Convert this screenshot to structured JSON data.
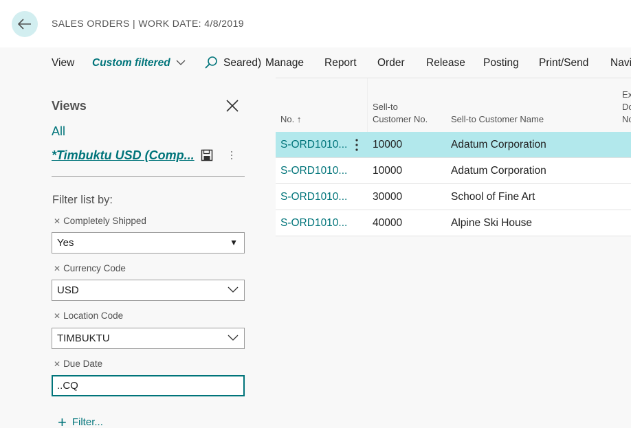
{
  "header": {
    "title": "SALES ORDERS | WORK DATE: 4/8/2019"
  },
  "actions": {
    "view": "View",
    "filtered": "Custom filtered",
    "search": "Seared)",
    "manage": "Manage",
    "report": "Report",
    "order": "Order",
    "release": "Release",
    "posting": "Posting",
    "print_send": "Print/Send",
    "navigate": "Navi"
  },
  "filter_pane": {
    "views_title": "Views",
    "view_all": "All",
    "current_view": "*Timbuktu USD (Comp...",
    "filter_list_by": "Filter list by:",
    "filters": [
      {
        "label": "Completely Shipped",
        "value": "Yes"
      },
      {
        "label": "Currency Code",
        "value": "USD"
      },
      {
        "label": "Location Code",
        "value": "TIMBUKTU"
      },
      {
        "label": "Due Date",
        "value": "..CQ"
      }
    ],
    "add_filter": "Filter..."
  },
  "table": {
    "columns": {
      "no": "No. ↑",
      "custno_line1": "Sell-to",
      "custno_line2": "Customer No.",
      "custname": "Sell-to Customer Name",
      "extdoc_line1": "Ex",
      "extdoc_line2": "Do",
      "extdoc_line3": "No"
    },
    "rows": [
      {
        "no": "S-ORD1010...",
        "custno": "10000",
        "custname": "Adatum Corporation"
      },
      {
        "no": "S-ORD1010...",
        "custno": "10000",
        "custname": "Adatum Corporation"
      },
      {
        "no": "S-ORD1010...",
        "custno": "30000",
        "custname": "School of Fine Art"
      },
      {
        "no": "S-ORD1010...",
        "custno": "40000",
        "custname": "Alpine Ski House"
      }
    ]
  },
  "colors": {
    "accent": "#00747a",
    "selected_row": "#b2e8ec",
    "back_button": "#d2eef0"
  }
}
